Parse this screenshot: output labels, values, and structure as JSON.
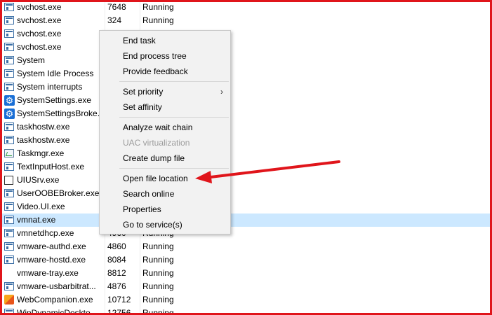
{
  "processes": [
    {
      "name": "svchost.exe",
      "pid": "7648",
      "status": "Running",
      "icon": "window-icon"
    },
    {
      "name": "svchost.exe",
      "pid": "324",
      "status": "Running",
      "icon": "window-icon"
    },
    {
      "name": "svchost.exe",
      "pid": "",
      "status": "",
      "icon": "window-icon"
    },
    {
      "name": "svchost.exe",
      "pid": "",
      "status": "",
      "icon": "window-icon"
    },
    {
      "name": "System",
      "pid": "",
      "status": "",
      "icon": "window-icon"
    },
    {
      "name": "System Idle Process",
      "pid": "",
      "status": "",
      "icon": "window-icon"
    },
    {
      "name": "System interrupts",
      "pid": "",
      "status": "",
      "icon": "window-icon"
    },
    {
      "name": "SystemSettings.exe",
      "pid": "",
      "status": "",
      "icon": "gear-icon"
    },
    {
      "name": "SystemSettingsBroke...",
      "pid": "",
      "status": "",
      "icon": "gear-icon"
    },
    {
      "name": "taskhostw.exe",
      "pid": "",
      "status": "",
      "icon": "window-icon"
    },
    {
      "name": "taskhostw.exe",
      "pid": "",
      "status": "",
      "icon": "window-icon"
    },
    {
      "name": "Taskmgr.exe",
      "pid": "",
      "status": "",
      "icon": "task-manager-icon"
    },
    {
      "name": "TextInputHost.exe",
      "pid": "",
      "status": "",
      "icon": "window-icon"
    },
    {
      "name": "UIUSrv.exe",
      "pid": "",
      "status": "",
      "icon": "blank-window-icon"
    },
    {
      "name": "UserOOBEBroker.exe",
      "pid": "",
      "status": "",
      "icon": "window-icon"
    },
    {
      "name": "Video.UI.exe",
      "pid": "",
      "status": "",
      "icon": "window-icon"
    },
    {
      "name": "vmnat.exe",
      "pid": "",
      "status": "",
      "icon": "window-icon",
      "selected": true
    },
    {
      "name": "vmnetdhcp.exe",
      "pid": "4960",
      "status": "Running",
      "icon": "window-icon"
    },
    {
      "name": "vmware-authd.exe",
      "pid": "4860",
      "status": "Running",
      "icon": "window-icon"
    },
    {
      "name": "vmware-hostd.exe",
      "pid": "8084",
      "status": "Running",
      "icon": "window-icon"
    },
    {
      "name": "vmware-tray.exe",
      "pid": "8812",
      "status": "Running",
      "icon": "none"
    },
    {
      "name": "vmware-usbarbitrat...",
      "pid": "4876",
      "status": "Running",
      "icon": "window-icon"
    },
    {
      "name": "WebCompanion.exe",
      "pid": "10712",
      "status": "Running",
      "icon": "webcompanion-icon"
    },
    {
      "name": "WinDynamicDeskto...",
      "pid": "12756",
      "status": "Running",
      "icon": "window-icon"
    }
  ],
  "context_menu": {
    "items": [
      {
        "label": "End task",
        "enabled": true
      },
      {
        "label": "End process tree",
        "enabled": true
      },
      {
        "label": "Provide feedback",
        "enabled": true
      },
      {
        "separator": true
      },
      {
        "label": "Set priority",
        "enabled": true,
        "submenu": true
      },
      {
        "label": "Set affinity",
        "enabled": true
      },
      {
        "separator": true
      },
      {
        "label": "Analyze wait chain",
        "enabled": true
      },
      {
        "label": "UAC virtualization",
        "enabled": false
      },
      {
        "label": "Create dump file",
        "enabled": true
      },
      {
        "separator": true
      },
      {
        "label": "Open file location",
        "enabled": true,
        "highlighted_by_annotation": true
      },
      {
        "label": "Search online",
        "enabled": true
      },
      {
        "label": "Properties",
        "enabled": true
      },
      {
        "label": "Go to service(s)",
        "enabled": true
      }
    ],
    "submenu_glyph": "›"
  },
  "colors": {
    "frame": "#e0151b",
    "annotation_arrow": "#e0151b",
    "selected_row": "#cce8ff",
    "menu_background": "#f2f2f2",
    "disabled_text": "#9c9c9c"
  }
}
